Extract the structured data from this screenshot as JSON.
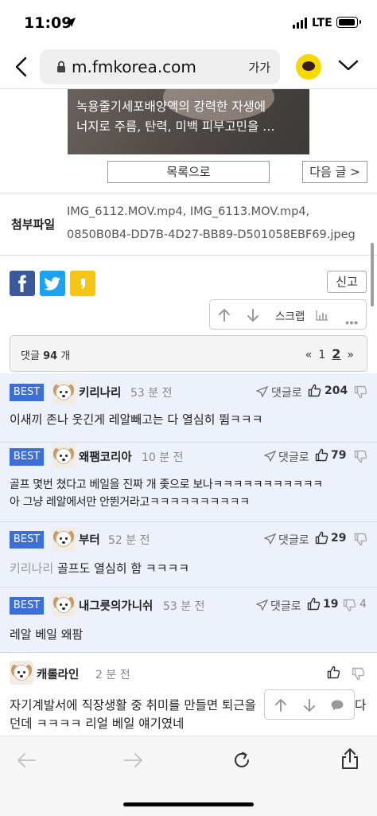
{
  "status_bar": {
    "time": "11:09",
    "network": "LTE"
  },
  "browser": {
    "url": "m.fmkorea.com",
    "text_size_label": "가가"
  },
  "ad_banner": {
    "line1": "녹용줄기세포배양액의 강력한 자생에",
    "line2": "너지로 주름, 탄력, 미백 피부고민을 …"
  },
  "nav": {
    "list_label": "목록으로",
    "next_label": "다음 글 >"
  },
  "attachments": {
    "label": "첨부파일",
    "line1": "IMG_6112.MOV.mp4,   IMG_6113.MOV.mp4,",
    "line2": "0850B0B4-DD7B-4D27-BB89-D501058EBF69.jpeg"
  },
  "actions": {
    "report_label": "신고",
    "scrap_label": "스크랩"
  },
  "comments_header": {
    "label_prefix": "댓글",
    "count": "94",
    "label_suffix": "개",
    "prev": "«",
    "page1": "1",
    "page2": "2",
    "next": "»"
  },
  "best_comments": [
    {
      "badge": "BEST",
      "nick": "키리나리",
      "time": "53 분 전",
      "reply": "댓글로",
      "likes": "204",
      "dislikes": "",
      "mention": "",
      "text": "이새끼 존나 웃긴게 레알빼고는 다 열심히 뜀ㅋㅋㅋ",
      "text2": ""
    },
    {
      "badge": "BEST",
      "nick": "왜팸코리아",
      "time": "10 분 전",
      "reply": "댓글로",
      "likes": "79",
      "dislikes": "",
      "mention": "",
      "text": "골프 몇번 쳤다고 베일을 진짜 개 좇으로 보나ㅋㅋㅋㅋㅋㅋㅋㅋㅋㅋㅋ",
      "text2": "아 그냥 레알에서만 안뛴거라고ㅋㅋㅋㅋㅋㅋㅋㅋㅋㅋ"
    },
    {
      "badge": "BEST",
      "nick": "부터",
      "time": "52 분 전",
      "reply": "댓글로",
      "likes": "29",
      "dislikes": "",
      "mention": "키리나리",
      "text": "골프도 열심히 함 ㅋㅋㅋㅋ",
      "text2": ""
    },
    {
      "badge": "BEST",
      "nick": "내그릇의가니쉬",
      "time": "53 분 전",
      "reply": "댓글로",
      "likes": "19",
      "dislikes": "4",
      "mention": "",
      "text": "레알 베일 왜팜",
      "text2": ""
    }
  ],
  "normal_comment": {
    "nick": "캐롤라인",
    "time": "2 분 전",
    "text": "자기계발서에 직장생활 중 취미를 만들면 퇴근을",
    "text_tail": "다",
    "text2": "던데 ㅋㅋㅋㅋ 리얼 베일 얘기였네"
  },
  "colors": {
    "best_badge": "#3c6fd8",
    "best_background": "#edf1fb",
    "facebook": "#3b5998",
    "twitter": "#1da1f2",
    "kakao": "#f5c518"
  }
}
